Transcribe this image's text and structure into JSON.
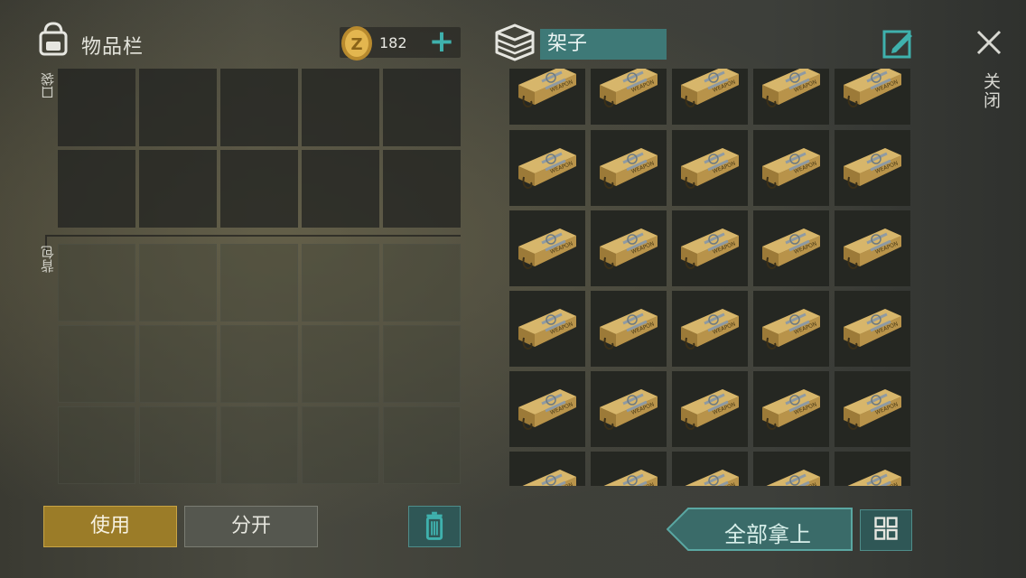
{
  "inventory": {
    "title": "物品栏",
    "pocket_label": "口袋",
    "backpack_label": "背包",
    "coins": "182",
    "add_coin_label": "+"
  },
  "storage": {
    "name": "架子",
    "item_name": "WEAPON crate",
    "visible_rows": 6,
    "columns": 5
  },
  "close": {
    "label": "关闭"
  },
  "buttons": {
    "use": "使用",
    "split": "分开",
    "take_all": "全部拿上"
  },
  "colors": {
    "accent_teal": "#3fb1ad",
    "use_gold": "#9b7c28",
    "container_name_bg": "#3e7977"
  }
}
